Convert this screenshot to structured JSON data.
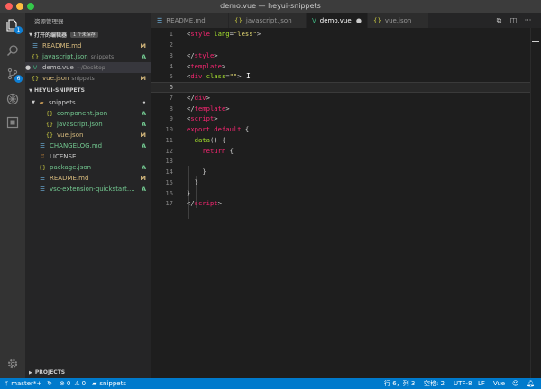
{
  "window": {
    "title": "demo.vue — heyui-snippets"
  },
  "activity": {
    "explorer_badge": "1",
    "scm_badge": "6"
  },
  "sidebar": {
    "header": "资源管理器",
    "open_editors": {
      "title": "打开的编辑器",
      "dirty_badge": "1 个未保存",
      "items": [
        {
          "name": "README.md",
          "desc": "",
          "icon": "markdown-icon",
          "status": "M"
        },
        {
          "name": "javascript.json",
          "desc": "snippets",
          "icon": "json-icon",
          "status": "A"
        },
        {
          "name": "demo.vue",
          "desc": "~/Desktop",
          "icon": "vue-icon",
          "status": ""
        },
        {
          "name": "vue.json",
          "desc": "snippets",
          "icon": "json-icon",
          "status": "M"
        }
      ]
    },
    "workspace": {
      "title": "HEYUI-SNIPPETS",
      "items": [
        {
          "name": "snippets",
          "icon": "folder-icon",
          "status": "•"
        },
        {
          "name": "component.json",
          "icon": "json-icon",
          "status": "A"
        },
        {
          "name": "javascript.json",
          "icon": "json-icon",
          "status": "A"
        },
        {
          "name": "vue.json",
          "icon": "json-icon",
          "status": "M"
        },
        {
          "name": "CHANGELOG.md",
          "icon": "markdown-icon",
          "status": "A"
        },
        {
          "name": "LICENSE",
          "icon": "license-icon",
          "status": ""
        },
        {
          "name": "package.json",
          "icon": "json-icon",
          "status": "A"
        },
        {
          "name": "README.md",
          "icon": "markdown-icon",
          "status": "M"
        },
        {
          "name": "vsc-extension-quickstart....",
          "icon": "markdown-icon",
          "status": "A"
        }
      ]
    },
    "projects_title": "PROJECTS"
  },
  "tabs": [
    {
      "label": "README.md",
      "icon": "markdown-icon"
    },
    {
      "label": "javascript.json",
      "icon": "json-icon"
    },
    {
      "label": "demo.vue",
      "icon": "vue-icon"
    },
    {
      "label": "vue.json",
      "icon": "json-icon"
    }
  ],
  "editor": {
    "line_numbers": [
      "1",
      "2",
      "3",
      "4",
      "5",
      "6",
      "7",
      "8",
      "9",
      "10",
      "11",
      "12",
      "13",
      "14",
      "15",
      "16",
      "17"
    ],
    "current_line": 6
  },
  "status": {
    "branch": "master*+",
    "errors": "0",
    "warnings": "0",
    "folder": "snippets",
    "cursor": "行 6，列 3",
    "indent": "空格: 2",
    "encoding": "UTF-8",
    "eol": "LF",
    "language": "Vue"
  },
  "colors": {
    "accent": "#007acc",
    "modified": "#d7ba7d",
    "added": "#73c991"
  }
}
